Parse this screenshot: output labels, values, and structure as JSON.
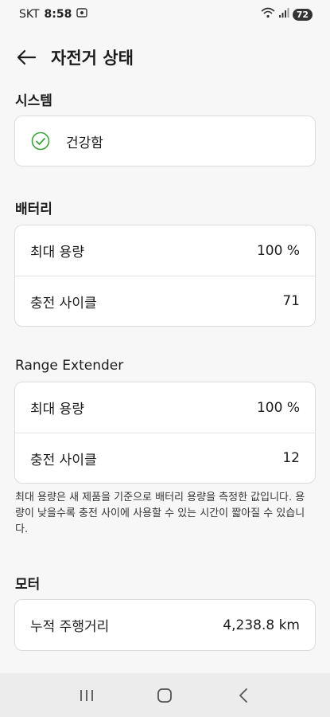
{
  "status": {
    "carrier": "SKT",
    "time": "8:58",
    "battery": "72"
  },
  "header": {
    "title": "자전거 상태"
  },
  "system": {
    "title": "시스템",
    "status_label": "건강함"
  },
  "battery": {
    "title": "배터리",
    "rows": [
      {
        "label": "최대 용량",
        "value": "100 %"
      },
      {
        "label": "충전 사이클",
        "value": "71"
      }
    ]
  },
  "range_extender": {
    "title": "Range Extender",
    "rows": [
      {
        "label": "최대 용량",
        "value": "100 %"
      },
      {
        "label": "충전 사이클",
        "value": "12"
      }
    ]
  },
  "note": "최대 용량은 새 제품을 기준으로 배터리 용량을 측정한 값입니다. 용량이 낮을수록 충전 사이에 사용할 수 있는 시간이 짧아질 수 있습니다.",
  "motor": {
    "title": "모터",
    "rows": [
      {
        "label": "누적 주행거리",
        "value": "4,238.8 km"
      }
    ]
  },
  "colors": {
    "accent_green": "#3aa33a",
    "background": "#f7f7f7"
  }
}
